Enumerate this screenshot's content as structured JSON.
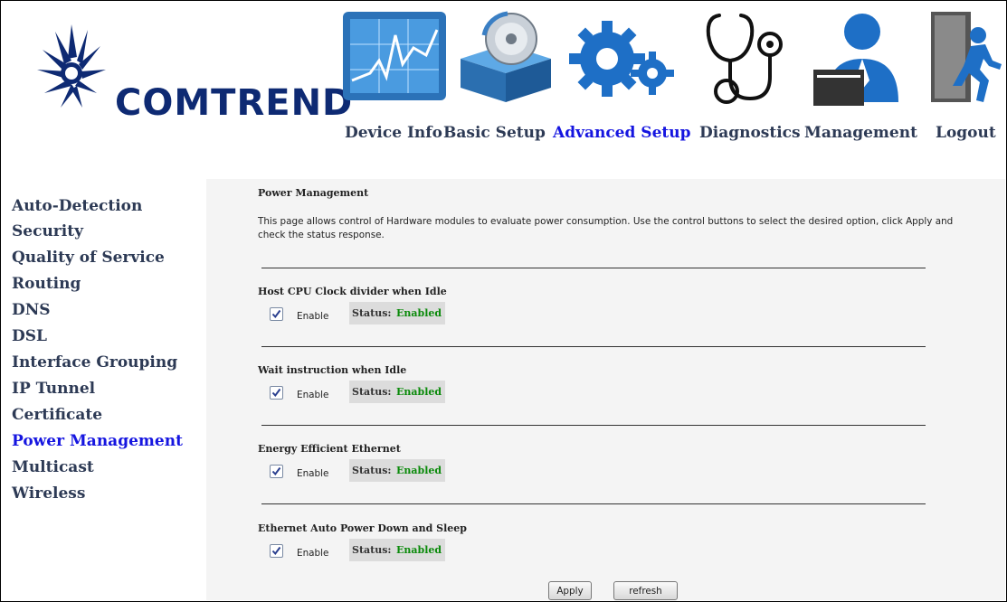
{
  "brand": {
    "logo_text": "COMTREND"
  },
  "nav": [
    {
      "label": "Device Info",
      "icon": "chart-icon"
    },
    {
      "label": "Basic Setup",
      "icon": "package-disc-icon"
    },
    {
      "label": "Advanced Setup",
      "icon": "gears-icon",
      "active": true
    },
    {
      "label": "Diagnostics",
      "icon": "stethoscope-icon"
    },
    {
      "label": "Management",
      "icon": "user-admin-icon"
    },
    {
      "label": "Logout",
      "icon": "exit-door-icon"
    }
  ],
  "sidebar": {
    "items": [
      {
        "label": "Auto-Detection"
      },
      {
        "label": "Security"
      },
      {
        "label": "Quality of Service"
      },
      {
        "label": "Routing"
      },
      {
        "label": "DNS"
      },
      {
        "label": "DSL"
      },
      {
        "label": "Interface Grouping"
      },
      {
        "label": "IP Tunnel"
      },
      {
        "label": "Certificate"
      },
      {
        "label": "Power Management",
        "active": true
      },
      {
        "label": "Multicast"
      },
      {
        "label": "Wireless"
      }
    ]
  },
  "page": {
    "title": "Power Management",
    "description": "This page allows control of Hardware modules to evaluate power consumption. Use the control buttons to select the desired option, click Apply and check the status response.",
    "sections": [
      {
        "title": "Host CPU Clock divider when Idle",
        "enable_label": "Enable",
        "checked": true,
        "status_label": "Status:",
        "status_value": "Enabled"
      },
      {
        "title": "Wait instruction when Idle",
        "enable_label": "Enable",
        "checked": true,
        "status_label": "Status:",
        "status_value": "Enabled"
      },
      {
        "title": "Energy Efficient Ethernet",
        "enable_label": "Enable",
        "checked": true,
        "status_label": "Status:",
        "status_value": "Enabled"
      },
      {
        "title": "Ethernet Auto Power Down and Sleep",
        "enable_label": "Enable",
        "checked": true,
        "status_label": "Status:",
        "status_value": "Enabled"
      }
    ],
    "apply_label": "Apply",
    "refresh_label": "refresh"
  },
  "colors": {
    "link": "#1515e0",
    "text": "#2d3a55",
    "status_ok": "#0a8a0a",
    "logo": "#0e2a73"
  }
}
